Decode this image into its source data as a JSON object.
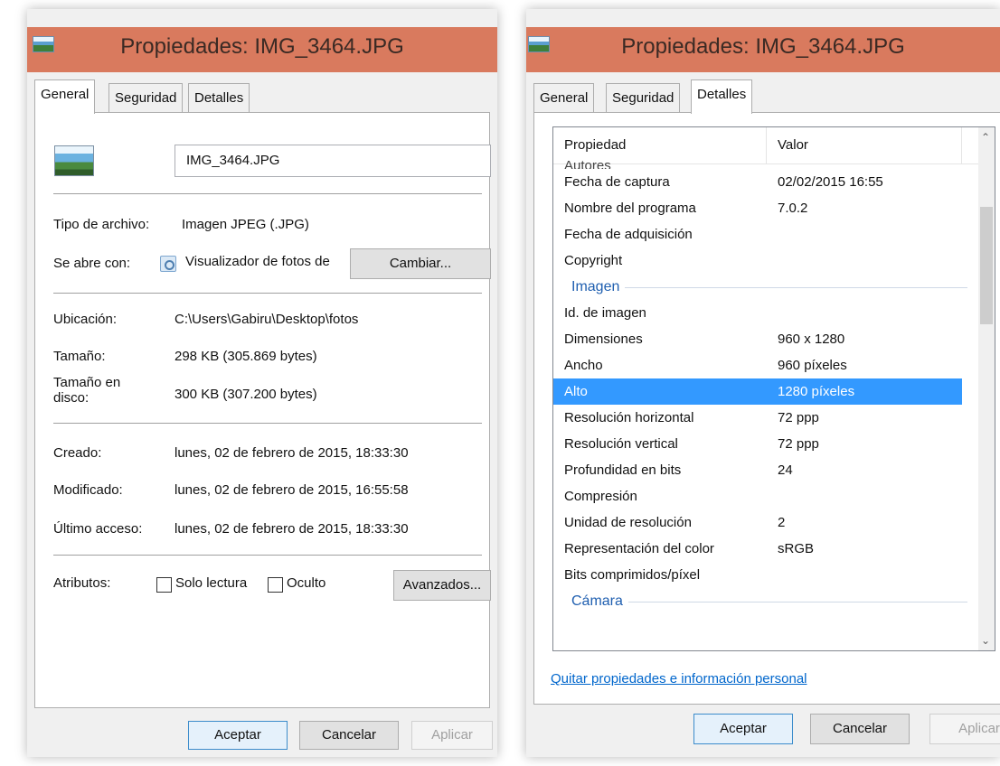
{
  "left": {
    "title": "Propiedades: IMG_3464.JPG",
    "tabs": [
      "General",
      "Seguridad",
      "Detalles"
    ],
    "filename": "IMG_3464.JPG",
    "tipo_label": "Tipo de archivo:",
    "tipo_value": "Imagen JPEG (.JPG)",
    "abre_label": "Se abre con:",
    "abre_value": "Visualizador de fotos de",
    "cambiar": "Cambiar...",
    "ubicacion_label": "Ubicación:",
    "ubicacion_value": "C:\\Users\\Gabiru\\Desktop\\fotos",
    "tamano_label": "Tamaño:",
    "tamano_value": "298 KB (305.869 bytes)",
    "tamano_disco_label_1": "Tamaño en",
    "tamano_disco_label_2": "disco:",
    "tamano_disco_value": "300 KB (307.200 bytes)",
    "creado_label": "Creado:",
    "creado_value": "lunes, 02 de febrero de 2015, 18:33:30",
    "modificado_label": "Modificado:",
    "modificado_value": "lunes, 02 de febrero de 2015, 16:55:58",
    "acceso_label": "Último acceso:",
    "acceso_value": "lunes, 02 de febrero de 2015, 18:33:30",
    "atributos_label": "Atributos:",
    "solo_lectura": "Solo lectura",
    "oculto": "Oculto",
    "avanzados": "Avanzados...",
    "aceptar": "Aceptar",
    "cancelar": "Cancelar",
    "aplicar": "Aplicar"
  },
  "right": {
    "title": "Propiedades: IMG_3464.JPG",
    "tabs": [
      "General",
      "Seguridad",
      "Detalles"
    ],
    "col_propiedad": "Propiedad",
    "col_valor": "Valor",
    "partial_top": "Autores",
    "rows_a": [
      {
        "p": "Fecha de captura",
        "v": "02/02/2015 16:55"
      },
      {
        "p": "Nombre del programa",
        "v": "7.0.2"
      },
      {
        "p": "Fecha de adquisición",
        "v": ""
      },
      {
        "p": "Copyright",
        "v": ""
      }
    ],
    "group_imagen": "Imagen",
    "rows_b": [
      {
        "p": "Id. de imagen",
        "v": ""
      },
      {
        "p": "Dimensiones",
        "v": "960 x 1280"
      },
      {
        "p": "Ancho",
        "v": "960 píxeles"
      },
      {
        "p": "Alto",
        "v": "1280 píxeles"
      },
      {
        "p": "Resolución horizontal",
        "v": "72 ppp"
      },
      {
        "p": "Resolución vertical",
        "v": "72 ppp"
      },
      {
        "p": "Profundidad en bits",
        "v": "24"
      },
      {
        "p": "Compresión",
        "v": ""
      },
      {
        "p": "Unidad de resolución",
        "v": "2"
      },
      {
        "p": "Representación del color",
        "v": "sRGB"
      },
      {
        "p": "Bits comprimidos/píxel",
        "v": ""
      }
    ],
    "selected_row": "Alto",
    "group_camara": "Cámara",
    "link": "Quitar propiedades e información personal",
    "aceptar": "Aceptar",
    "cancelar": "Cancelar",
    "aplicar": "Aplicar"
  },
  "colors": {
    "titlebar": "#d97a5e",
    "selection": "#3399ff",
    "link": "#0066cc",
    "group": "#1f5fb0"
  }
}
